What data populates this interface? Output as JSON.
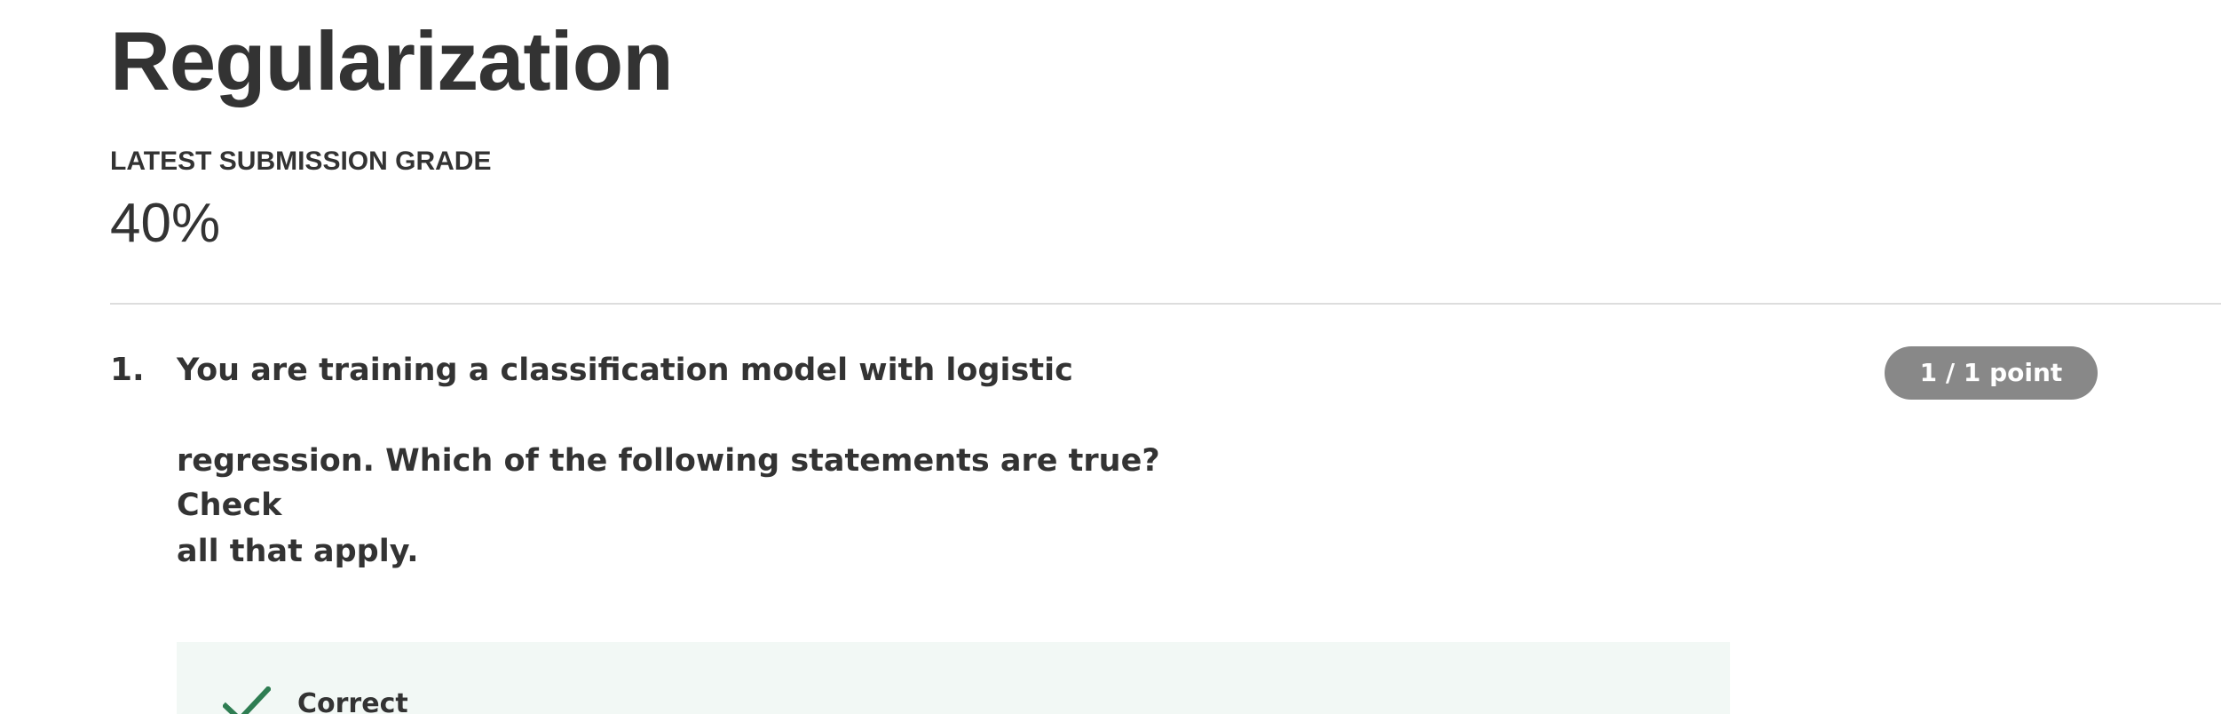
{
  "quiz": {
    "title": "Regularization",
    "grade_label": "LATEST SUBMISSION GRADE",
    "grade_value": "40%"
  },
  "questions": [
    {
      "number": "1.",
      "text_lines": [
        "You are training a classification model with logistic",
        "regression. Which of the following statements are true? Check",
        "all that apply."
      ],
      "points": "1 / 1 point",
      "feedback": {
        "label": "Correct",
        "icon": "checkmark-icon"
      }
    }
  ],
  "colors": {
    "text": "#333333",
    "divider": "#dddddd",
    "badge_background": "#888888",
    "badge_text": "#ffffff",
    "correct_background": "#f2f8f5",
    "correct_icon": "#2e7d52"
  }
}
